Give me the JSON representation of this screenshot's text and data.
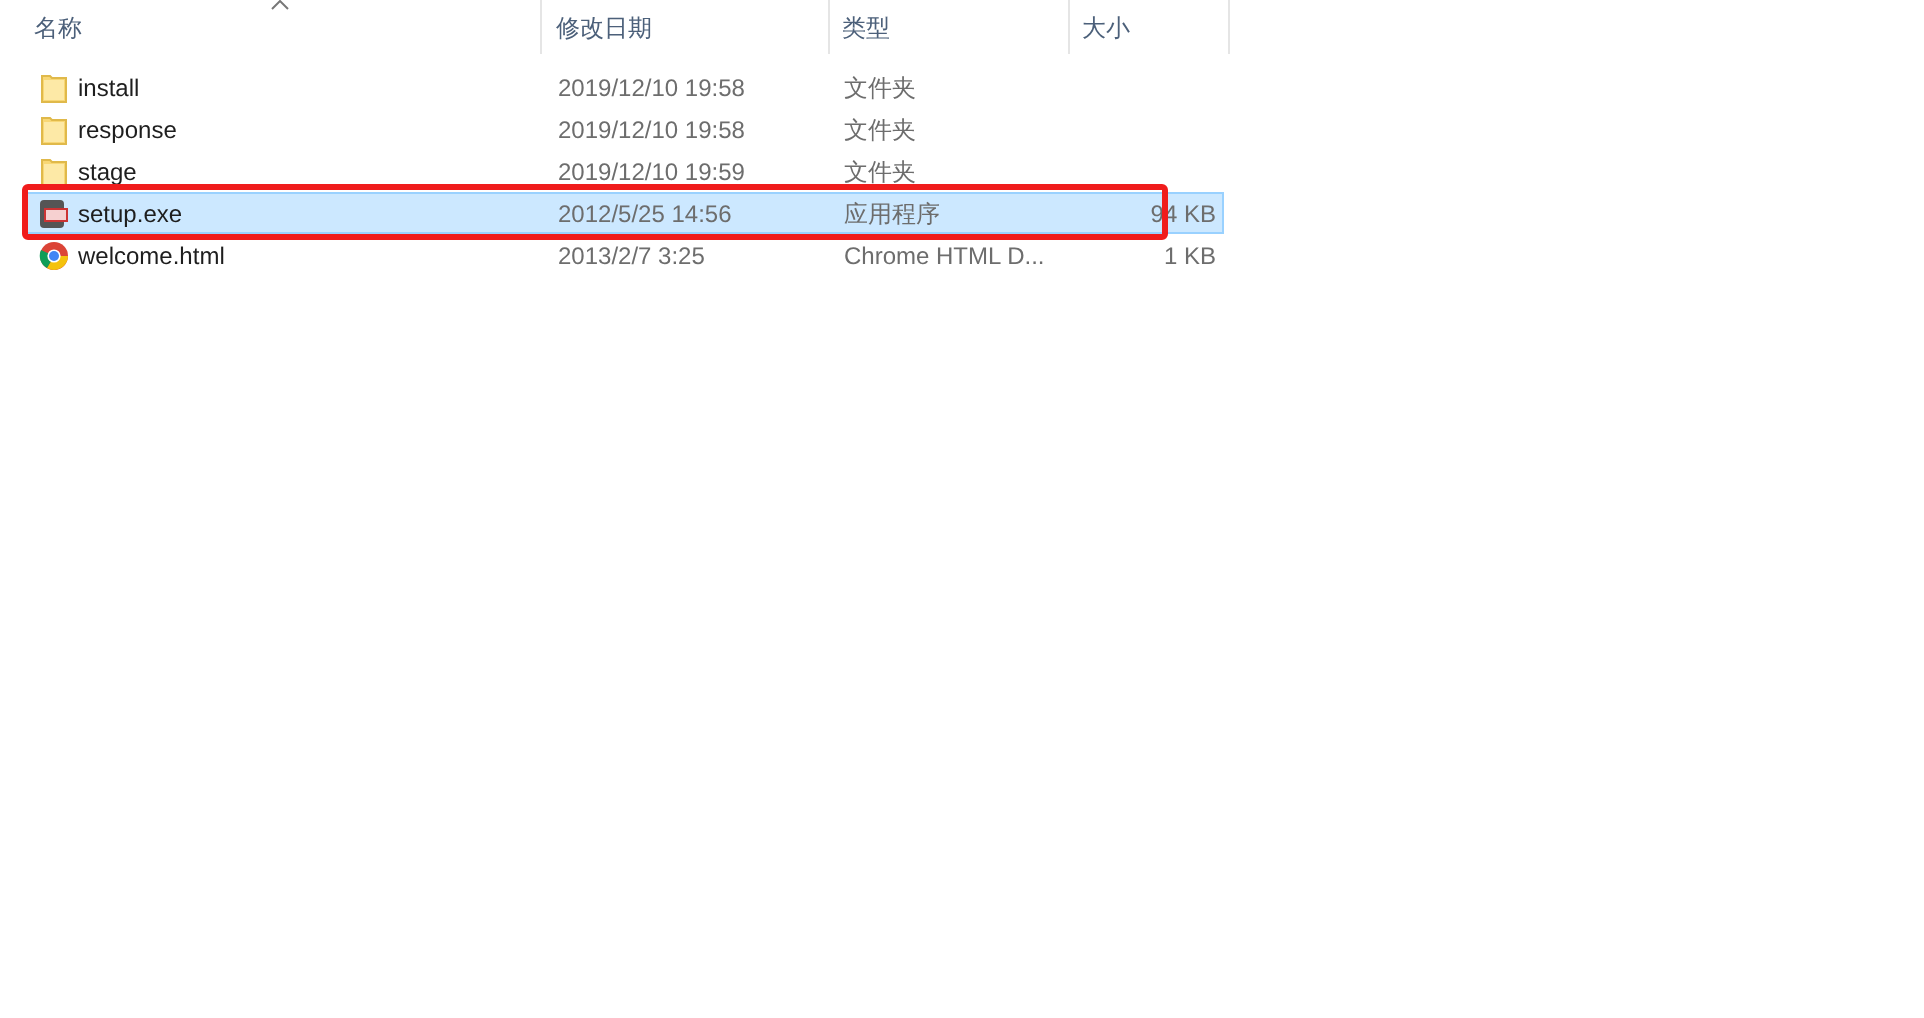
{
  "columns": [
    {
      "label": "名称",
      "sorted": true
    },
    {
      "label": "修改日期",
      "sorted": false
    },
    {
      "label": "类型",
      "sorted": false
    },
    {
      "label": "大小",
      "sorted": false
    }
  ],
  "rows": [
    {
      "kind": "folder",
      "name": "install",
      "date": "2019/12/10 19:58",
      "type": "文件夹",
      "size": "",
      "selected": false,
      "annotated": false
    },
    {
      "kind": "folder",
      "name": "response",
      "date": "2019/12/10 19:58",
      "type": "文件夹",
      "size": "",
      "selected": false,
      "annotated": false
    },
    {
      "kind": "folder",
      "name": "stage",
      "date": "2019/12/10 19:59",
      "type": "文件夹",
      "size": "",
      "selected": false,
      "annotated": false
    },
    {
      "kind": "exe",
      "name": "setup.exe",
      "date": "2012/5/25 14:56",
      "type": "应用程序",
      "size": "94 KB",
      "selected": true,
      "annotated": true
    },
    {
      "kind": "html",
      "name": "welcome.html",
      "date": "2013/2/7 3:25",
      "type": "Chrome HTML D...",
      "size": "1 KB",
      "selected": false,
      "annotated": false
    }
  ]
}
